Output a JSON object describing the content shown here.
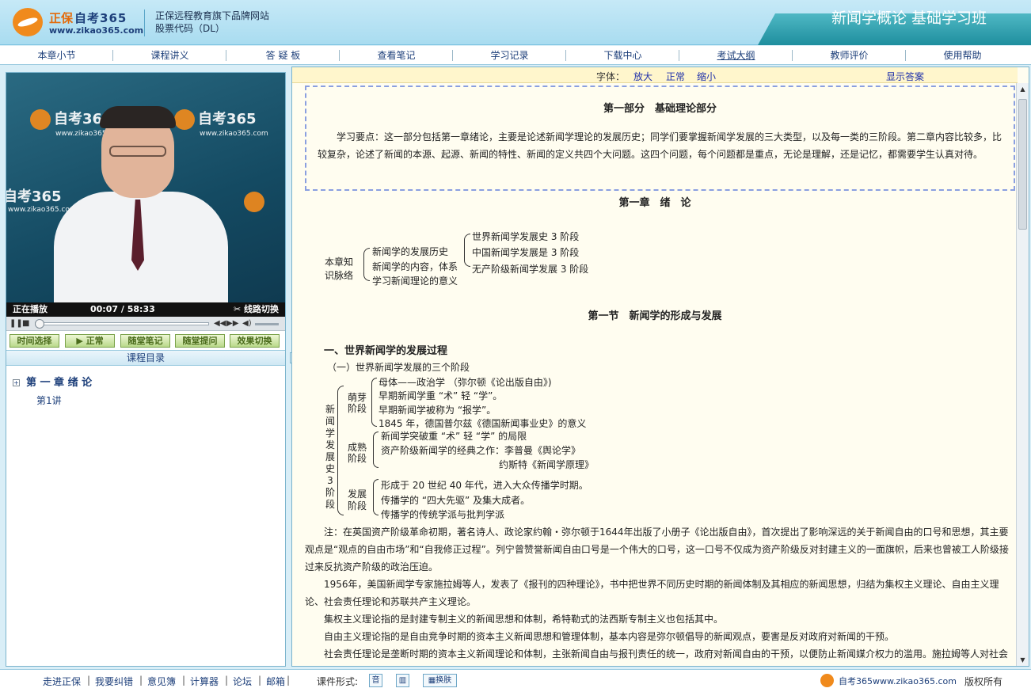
{
  "header": {
    "brand_cn": "正保",
    "brand_en": "自考365",
    "brand_url": "www.zikao365.com",
    "tagline_1": "正保远程教育旗下品牌网站",
    "tagline_2": "股票代码（DL）",
    "course_title": "新闻学概论 基础学习班"
  },
  "nav": {
    "items": [
      "本章小节",
      "课程讲义",
      "答 疑 板",
      "查看笔记",
      "学习记录",
      "下载中心",
      "考试大纲",
      "教师评价",
      "使用帮助"
    ]
  },
  "player": {
    "watermark_brand": "自考365",
    "watermark_url": "www.zikao365.com",
    "status": "正在播放",
    "time_current": "00:07",
    "time_total": "58:33",
    "time_sep": "/",
    "line_switch": "线路切换",
    "progress_fraction": 0.002,
    "buttons": [
      "时间选择",
      "▶ 正常",
      "随堂笔记",
      "随堂提问",
      "效果切换"
    ]
  },
  "catalog": {
    "title": "课程目录",
    "chapter": "第 一 章  绪  论",
    "expander": "+",
    "lesson": "第1讲"
  },
  "toolbar": {
    "font_label": "字体：",
    "enlarge": "放大",
    "normal": "正常",
    "shrink": "缩小",
    "show_answer": "显示答案"
  },
  "lecture": {
    "part_title": "第一部分　基础理论部分",
    "summary": "学习要点：这一部分包括第一章绪论，主要是论述新闻学理论的发展历史；同学们要掌握新闻学发展的三大类型，以及每一类的三阶段。第二章内容比较多，比较复杂，论述了新闻的本源、起源、新闻的特性、新闻的定义共四个大问题。这四个问题，每个问题都是重点，无论是理解，还是记忆，都需要学生认真对待。",
    "chapter_title": "第一章　绪　论",
    "outline": {
      "root_1": "本章知",
      "root_2": "识脉络",
      "mid": [
        "新闻学的发展历史",
        "新闻学的内容，体系",
        "学习新闻理论的意义"
      ],
      "right": [
        "世界新闻学发展史 3 阶段",
        "中国新闻学发展是 3 阶段",
        "无产阶级新闻学发展 3 阶段"
      ]
    },
    "section_title": "第一节　新闻学的形成与发展",
    "heading_1": "一、世界新闻学的发展过程",
    "heading_2": "（一）世界新闻学发展的三个阶段",
    "stages_root": "新闻学发展史3阶段",
    "stage_1": {
      "name_1": "萌芽",
      "name_2": "阶段",
      "items": [
        "母体——政治学 （弥尔顿《论出版自由》)",
        "早期新闻学重 “术” 轻 “学”。",
        "早期新闻学被称为 “报学”。",
        "1845 年，德国普尔兹《德国新闻事业史》的意义"
      ]
    },
    "stage_2": {
      "name_1": "成熟",
      "name_2": "阶段",
      "items": [
        "新闻学突破重 “术” 轻 “学” 的局限",
        "资产阶级新闻学的经典之作：李普曼《舆论学》",
        "约斯特《新闻学原理》"
      ]
    },
    "stage_3": {
      "name_1": "发展",
      "name_2": "阶段",
      "items": [
        "形成于 20 世纪 40 年代，进入大众传播学时期。",
        "传播学的 “四大先驱” 及集大成者。",
        "传播学的传统学派与批判学派"
      ]
    },
    "paragraphs": [
      "注：在英国资产阶级革命初期，著名诗人、政论家约翰・弥尔顿于1644年出版了小册子《论出版自由》，首次提出了影响深远的关于新闻自由的口号和思想，其主要观点是“观点的自由市场”和“自我修正过程”。列宁曾赞誉新闻自由口号是一个伟大的口号，这一口号不仅成为资产阶级反对封建主义的一面旗帜，后来也曾被工人阶级接过来反抗资产阶级的政治压迫。",
      "1956年，美国新闻学专家施拉姆等人，发表了《报刊的四种理论》，书中把世界不同历史时期的新闻体制及其相应的新闻思想，归结为集权主义理论、自由主义理论、社会责任理论和苏联共产主义理论。",
      "集权主义理论指的是封建专制主义的新闻思想和体制，希特勒式的法西斯专制主义也包括其中。",
      "自由主义理论指的是自由竞争时期的资本主义新闻思想和管理体制，基本内容是弥尔顿倡导的新闻观点，要害是反对政府对新闻的干预。",
      "社会责任理论是垄断时期的资本主义新闻理论和体制，主张新闻自由与报刊责任的统一，政府对新闻自由的干预，以便防止新闻媒介权力的滥用。施拉姆等人对社会"
    ]
  },
  "footer": {
    "links": [
      "走进正保",
      "我要纠错",
      "意见簿",
      "计算器",
      "论坛",
      "邮箱"
    ],
    "format_label": "课件形式:",
    "format_audio": "音",
    "skin": "换肤",
    "site": "自考365www.zikao365.com",
    "copyright": "版权所有"
  }
}
